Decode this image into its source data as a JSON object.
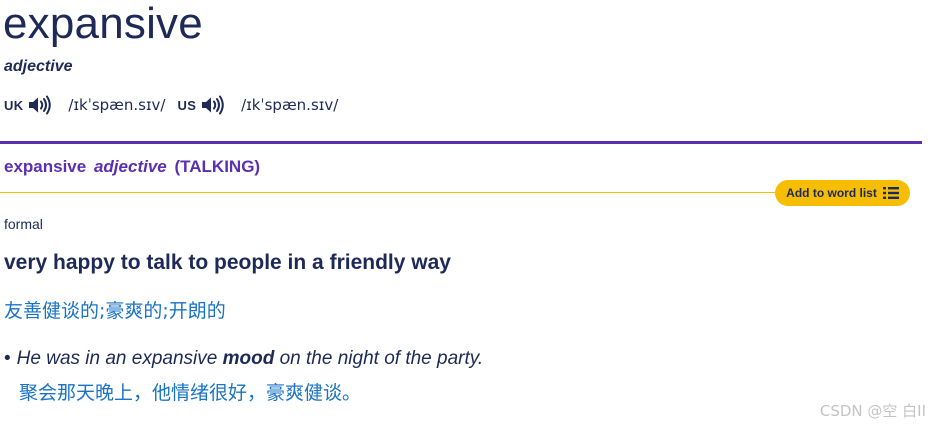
{
  "entry": {
    "headword": "expansive",
    "part_of_speech": "adjective",
    "pronunciations": [
      {
        "region": "UK",
        "ipa": "/ɪkˈspæn.sɪv/"
      },
      {
        "region": "US",
        "ipa": "/ɪkˈspæn.sɪv/"
      }
    ]
  },
  "sense": {
    "headword": "expansive",
    "part_of_speech": "adjective",
    "guideword": "(TALKING)",
    "add_to_list_label": "Add to word list",
    "register": "formal",
    "definition": "very happy to talk to people in a friendly way",
    "translation": "友善健谈的;豪爽的;开朗的",
    "example": {
      "before": "He was in an expansive ",
      "bold": "mood",
      "after": " on the night of the party.",
      "translation": "聚会那天晚上，他情绪很好，豪爽健谈。"
    }
  },
  "watermark": "CSDN @空 白II",
  "colors": {
    "navy": "#1d2a57",
    "purple": "#5a2fb0",
    "yellow": "#f7bd00",
    "translation_blue": "#1a73c4"
  },
  "icons": {
    "audio": "speaker-icon",
    "list": "list-icon"
  }
}
